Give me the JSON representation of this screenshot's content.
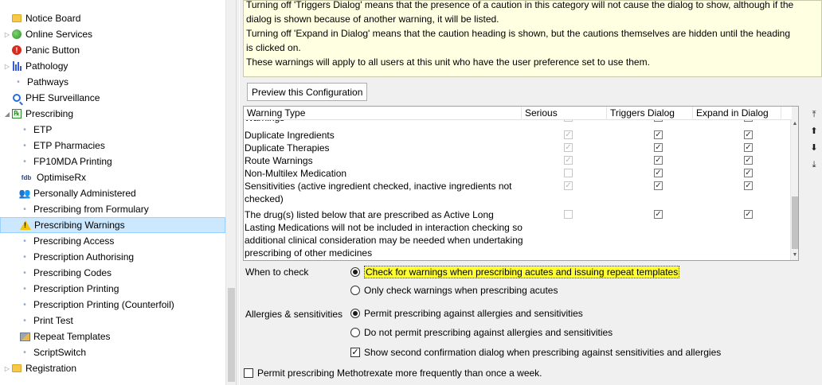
{
  "tree": {
    "items": [
      {
        "label": "Notice Board",
        "icon": "folder-icon",
        "expander": ""
      },
      {
        "label": "Online Services",
        "icon": "globe-icon",
        "expander": "▷"
      },
      {
        "label": "Panic Button",
        "icon": "panic-icon",
        "expander": ""
      },
      {
        "label": "Pathology",
        "icon": "bar-chart-icon",
        "expander": "▷"
      },
      {
        "label": "Pathways",
        "icon": "dot-icon",
        "expander": ""
      },
      {
        "label": "PHE Surveillance",
        "icon": "magnifier-icon",
        "expander": ""
      },
      {
        "label": "Prescribing",
        "icon": "prescribing-icon",
        "expander": "◢"
      },
      {
        "label": "ETP",
        "icon": "dot-icon",
        "expander": ""
      },
      {
        "label": "ETP Pharmacies",
        "icon": "dot-icon",
        "expander": ""
      },
      {
        "label": "FP10MDA Printing",
        "icon": "dot-icon",
        "expander": ""
      },
      {
        "label": "OptimiseRx",
        "icon": "fdb-icon",
        "expander": "",
        "icon_text": "fdb"
      },
      {
        "label": "Personally Administered",
        "icon": "people-icon",
        "expander": ""
      },
      {
        "label": "Prescribing from Formulary",
        "icon": "dot-icon",
        "expander": ""
      },
      {
        "label": "Prescribing Warnings",
        "icon": "warning-icon",
        "expander": "",
        "selected": true
      },
      {
        "label": "Prescribing Access",
        "icon": "dot-icon",
        "expander": ""
      },
      {
        "label": "Prescription Authorising",
        "icon": "dot-icon",
        "expander": ""
      },
      {
        "label": "Prescribing Codes",
        "icon": "dot-icon",
        "expander": ""
      },
      {
        "label": "Prescription Printing",
        "icon": "dot-icon",
        "expander": ""
      },
      {
        "label": "Prescription Printing (Counterfoil)",
        "icon": "dot-icon",
        "expander": ""
      },
      {
        "label": "Print Test",
        "icon": "dot-icon",
        "expander": ""
      },
      {
        "label": "Repeat Templates",
        "icon": "repeat-templates-icon",
        "expander": ""
      },
      {
        "label": "ScriptSwitch",
        "icon": "dot-icon",
        "expander": ""
      },
      {
        "label": "Registration",
        "icon": "folder-icon",
        "expander": "▷"
      }
    ]
  },
  "info": {
    "lines": [
      "Turning off 'Triggers Dialog' means that the presence of a caution in this category will not cause the dialog to show, although if the",
      "dialog is shown because of another warning, it will be listed.",
      "Turning off 'Expand in Dialog' means that the caution heading is shown, but the cautions themselves are hidden until the heading",
      "is clicked on.",
      "These warnings will apply to all users at this unit who have the user preference set to use them."
    ]
  },
  "preview_button": "Preview this Configuration",
  "grid": {
    "columns": [
      "Warning Type",
      "Serious",
      "Triggers Dialog",
      "Expand in Dialog"
    ],
    "rows": [
      {
        "name": "Warnings",
        "serious": true,
        "triggers": true,
        "expand": true
      },
      {
        "name": "Duplicate Ingredients",
        "serious": true,
        "triggers": true,
        "expand": true
      },
      {
        "name": "Duplicate Therapies",
        "serious": true,
        "triggers": true,
        "expand": true
      },
      {
        "name": "Route Warnings",
        "serious": true,
        "triggers": true,
        "expand": true
      },
      {
        "name": "Non-Multilex Medication",
        "serious": false,
        "triggers": true,
        "expand": true
      },
      {
        "name": "Sensitivities (active ingredient checked, inactive ingredients not checked)",
        "serious": true,
        "triggers": true,
        "expand": true
      },
      {
        "name": "The drug(s) listed below that are prescribed as Active Long Lasting Medications will not be included in interaction checking so additional clinical consideration may be needed when undertaking prescribing of other medicines",
        "serious": false,
        "triggers": true,
        "expand": true
      }
    ]
  },
  "side_buttons": [
    "move-top-icon",
    "move-up-icon",
    "move-down-icon",
    "move-bottom-icon"
  ],
  "when_to_check": {
    "label": "When to check",
    "options": [
      "Check for warnings when prescribing acutes and issuing repeat templates",
      "Only check warnings when prescribing acutes"
    ],
    "selected_index": 0
  },
  "allergies": {
    "label": "Allergies & sensitivities",
    "options": [
      "Permit prescribing against allergies and sensitivities",
      "Do not permit prescribing against allergies and sensitivities"
    ],
    "selected_index": 0,
    "confirm_label": "Show second confirmation dialog when prescribing against sensitivities and allergies",
    "confirm_checked": true
  },
  "methotrexate": {
    "label": "Permit prescribing Methotrexate more frequently than once a week.",
    "checked": false
  },
  "colors": {
    "selection": "#cce8ff",
    "info_bg": "#ffffe1",
    "highlight": "#ffff33",
    "pane_bg": "#f0f0f0"
  }
}
